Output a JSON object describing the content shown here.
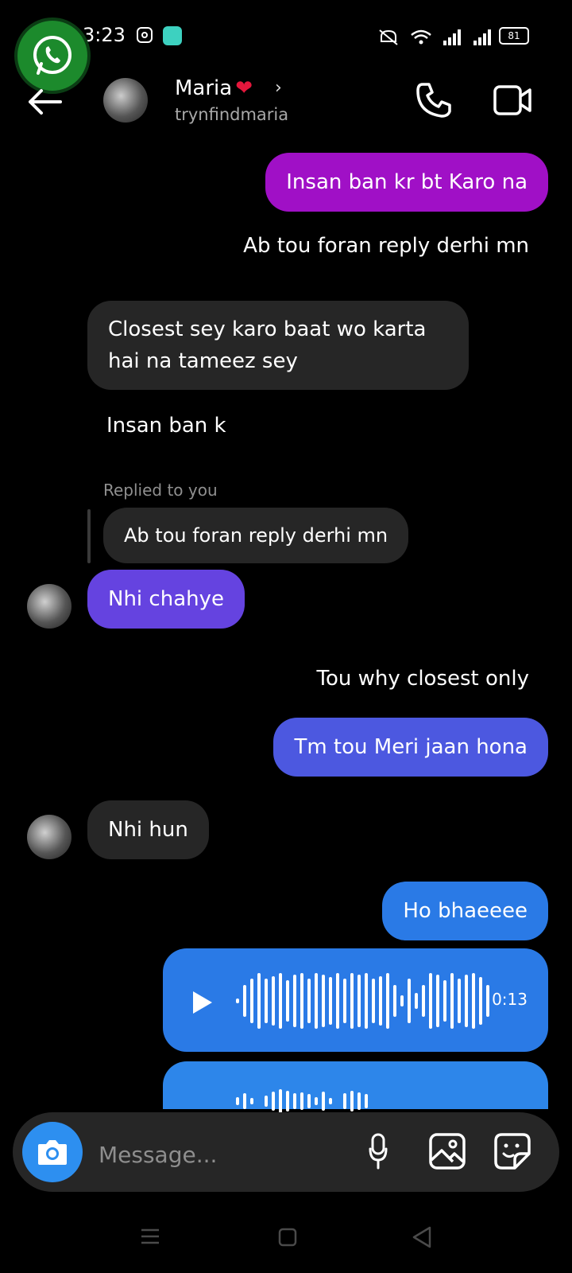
{
  "status_bar": {
    "time": "3:23",
    "battery": "81"
  },
  "header": {
    "name": "Maria",
    "heart": "❤",
    "chevron": "›",
    "username": "trynfindmaria"
  },
  "messages": [
    {
      "id": "m1",
      "text": "Insan ban kr bt Karo na",
      "side": "sent",
      "color": "#a010c6"
    },
    {
      "id": "m2",
      "text": "Ab tou foran reply derhi mn",
      "side": "sent",
      "style": "plain"
    },
    {
      "id": "m3",
      "text": "Closest sey karo baat wo karta hai na tameez sey",
      "line1": "Closest sey karo baat wo karta",
      "line2": "hai na tameez sey",
      "side": "received"
    },
    {
      "id": "m4",
      "text": "Insan ban k",
      "side": "received",
      "style": "plain"
    },
    {
      "id": "m5",
      "reply_label": "Replied to you",
      "quoted": "Ab tou foran reply derhi mn",
      "text": "Nhi chahye",
      "side": "received",
      "color": "#6543e0"
    },
    {
      "id": "m6",
      "text": "Tou why closest only",
      "side": "sent",
      "style": "plain"
    },
    {
      "id": "m7",
      "text": "Tm tou Meri jaan hona",
      "side": "sent",
      "color": "#4c58e0"
    },
    {
      "id": "m8",
      "text": "Nhi hun",
      "side": "received"
    },
    {
      "id": "m9",
      "text": "Ho bhaeeee",
      "side": "sent",
      "color": "#2a7ae6"
    },
    {
      "id": "m10",
      "type": "voice",
      "duration": "0:13",
      "side": "sent"
    }
  ],
  "composer": {
    "placeholder": "Message..."
  },
  "icons": [
    "whatsapp-icon",
    "instagram-icon",
    "back-arrow-icon",
    "phone-icon",
    "video-camera-icon",
    "play-icon",
    "camera-icon",
    "microphone-icon",
    "gallery-icon",
    "sticker-icon",
    "nav-menu-icon",
    "nav-home-icon",
    "nav-back-icon"
  ],
  "colors": {
    "sent_purple": "#a010c6",
    "sent_violet": "#6543e0",
    "sent_indigo": "#4c58e0",
    "sent_blue": "#2a7ae6",
    "received_bg": "#262626",
    "camera_button": "#2d8ff0"
  }
}
